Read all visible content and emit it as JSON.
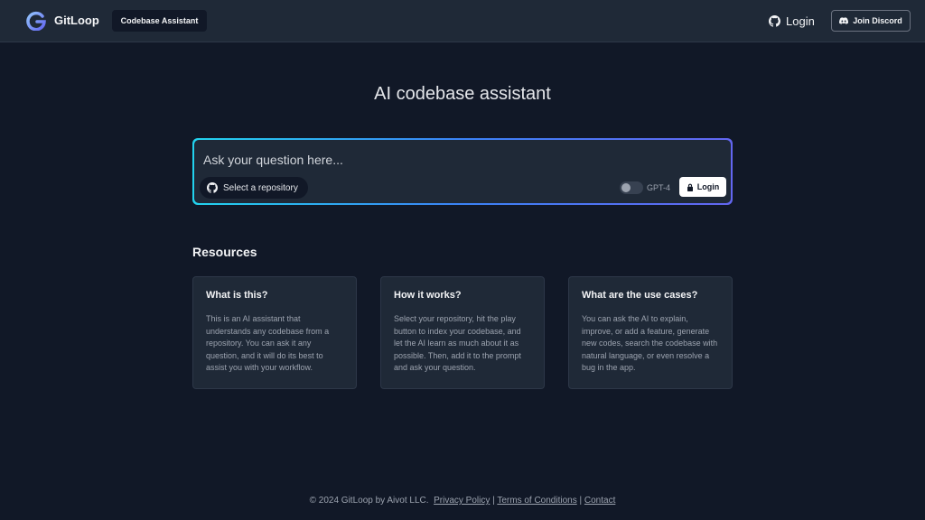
{
  "header": {
    "brand": "GitLoop",
    "nav_pill": "Codebase Assistant",
    "login": "Login",
    "discord": "Join Discord"
  },
  "hero": {
    "title": "AI codebase assistant"
  },
  "prompt": {
    "placeholder": "Ask your question here...",
    "repo_button": "Select a repository",
    "model_label": "GPT-4",
    "login_button": "Login"
  },
  "resources": {
    "heading": "Resources",
    "cards": [
      {
        "title": "What is this?",
        "body": "This is an AI assistant that understands any codebase from a repository. You can ask it any question, and it will do its best to assist you with your workflow."
      },
      {
        "title": "How it works?",
        "body": "Select your repository, hit the play button to index your codebase, and let the AI learn as much about it as possible. Then, add it to the prompt and ask your question."
      },
      {
        "title": "What are the use cases?",
        "body": "You can ask the AI to explain, improve, or add a feature, generate new codes, search the codebase with natural language, or even resolve a bug in the app."
      }
    ]
  },
  "footer": {
    "copyright": "© 2024 GitLoop by Aivot LLC.",
    "privacy": "Privacy Policy",
    "terms": "Terms of Conditions",
    "contact": "Contact",
    "separator": "|"
  },
  "colors": {
    "background": "#111827",
    "surface": "#1f2937",
    "accent_start": "#22d3ee",
    "accent_end": "#6366f1"
  },
  "icons": {
    "logo": "gitloop-logo-icon",
    "github": "github-icon",
    "discord": "discord-icon",
    "lock": "lock-icon"
  }
}
